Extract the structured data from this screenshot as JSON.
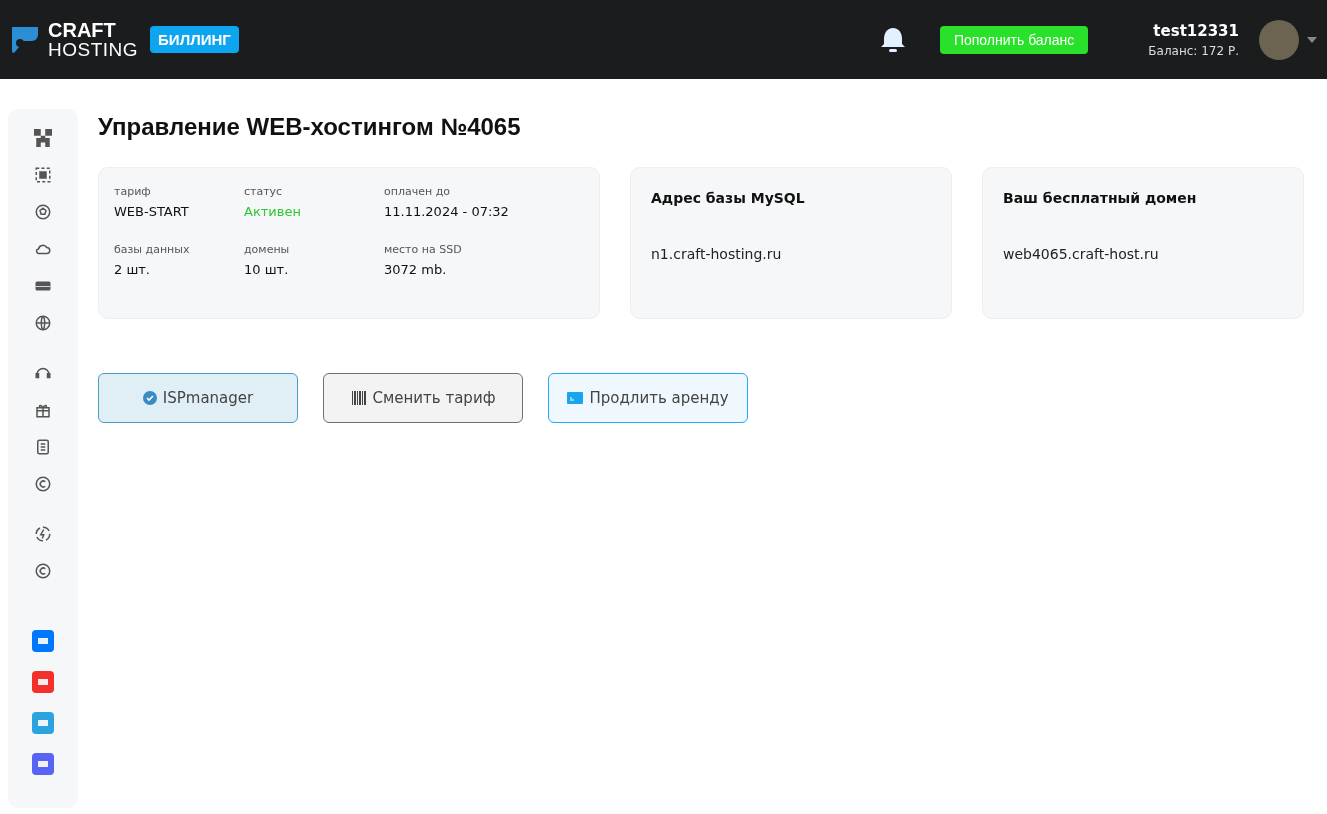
{
  "header": {
    "logo_top": "CRAFT",
    "logo_bottom": "HOSTING",
    "badge": "БИЛЛИНГ",
    "topup_button": "Пополнить баланс",
    "username": "test12331",
    "balance": "Баланс: 172 Р."
  },
  "page_title": "Управление WEB-хостингом №4065",
  "info_card": {
    "items": [
      {
        "label": "тариф",
        "value": "WEB-START",
        "kind": "plain"
      },
      {
        "label": "статус",
        "value": "Активен",
        "kind": "status"
      },
      {
        "label": "оплачен до",
        "value": "11.11.2024 - 07:32",
        "kind": "plain"
      },
      {
        "label": "базы данных",
        "value": "2 шт.",
        "kind": "plain"
      },
      {
        "label": "домены",
        "value": "10 шт.",
        "kind": "plain"
      },
      {
        "label": "место на SSD",
        "value": "3072 mb.",
        "kind": "plain"
      }
    ]
  },
  "address_cards": [
    {
      "title": "Адрес базы MySQL",
      "value": "n1.craft-hosting.ru"
    },
    {
      "title": "Ваш бесплатный домен",
      "value": "web4065.craft-host.ru"
    }
  ],
  "actions": [
    {
      "label": "ISPmanager",
      "kind": "panel"
    },
    {
      "label": "Сменить тариф",
      "kind": "tariff"
    },
    {
      "label": "Продлить аренду",
      "kind": "renew"
    }
  ]
}
